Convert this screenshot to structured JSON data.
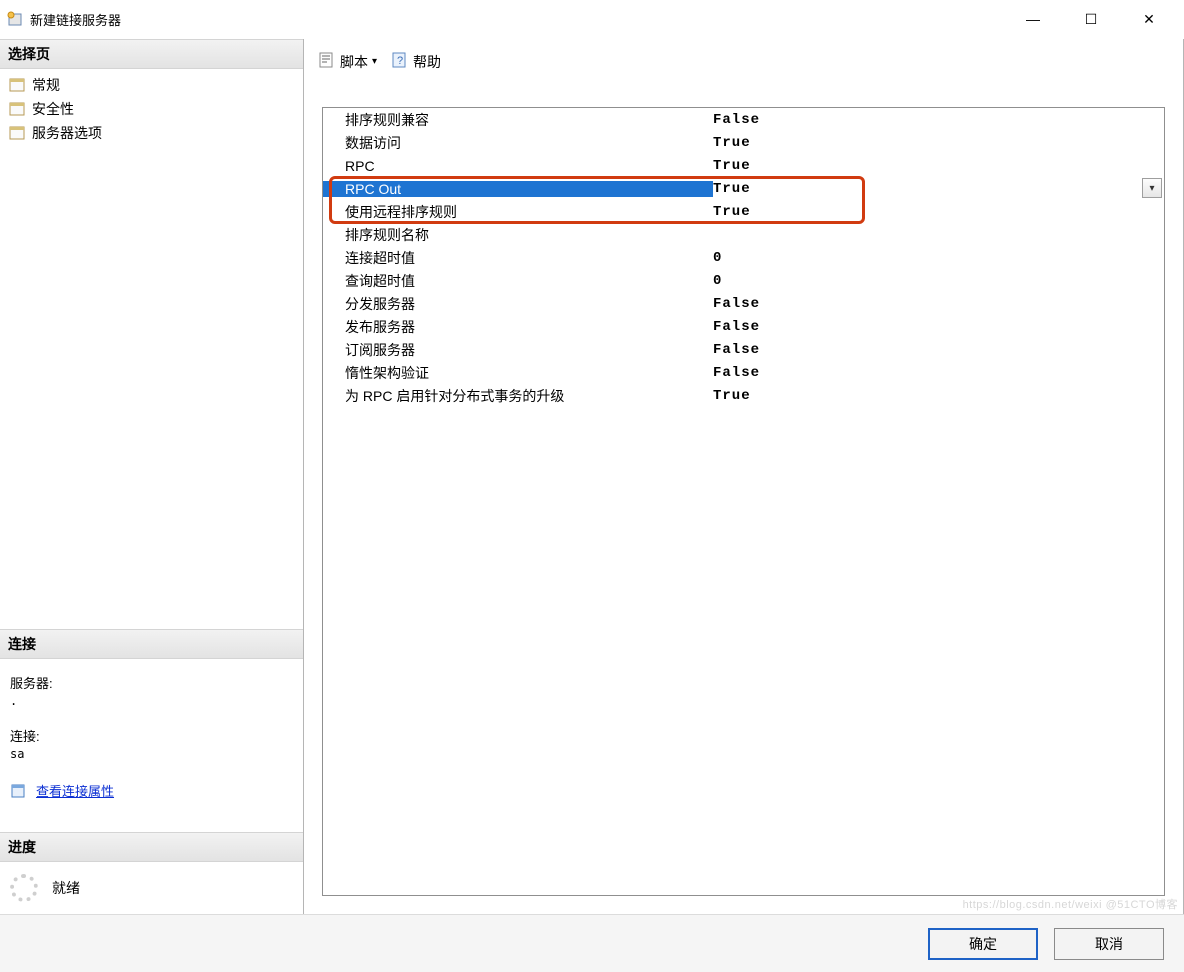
{
  "window": {
    "title": "新建链接服务器"
  },
  "winControls": {
    "minimize": "—",
    "maximize": "☐",
    "close": "✕"
  },
  "leftPane": {
    "selectPage": {
      "header": "选择页",
      "items": [
        "常规",
        "安全性",
        "服务器选项"
      ]
    },
    "connection": {
      "header": "连接",
      "serverLabel": "服务器:",
      "serverValue": ".",
      "connLabel": "连接:",
      "connValue": "sa",
      "viewPropsLink": "查看连接属性"
    },
    "progress": {
      "header": "进度",
      "status": "就绪"
    }
  },
  "toolbar": {
    "script": "脚本",
    "help": "帮助"
  },
  "properties": [
    {
      "key": "排序规则兼容",
      "value": "False"
    },
    {
      "key": "数据访问",
      "value": "True"
    },
    {
      "key": "RPC",
      "value": "True"
    },
    {
      "key": "RPC Out",
      "value": "True",
      "selected": true,
      "highlight": true
    },
    {
      "key": "使用远程排序规则",
      "value": "True",
      "highlight": true
    },
    {
      "key": "排序规则名称",
      "value": ""
    },
    {
      "key": "连接超时值",
      "value": "0"
    },
    {
      "key": "查询超时值",
      "value": "0"
    },
    {
      "key": "分发服务器",
      "value": "False"
    },
    {
      "key": "发布服务器",
      "value": "False"
    },
    {
      "key": "订阅服务器",
      "value": "False"
    },
    {
      "key": "惰性架构验证",
      "value": "False"
    },
    {
      "key": "为 RPC 启用针对分布式事务的升级",
      "value": "True"
    }
  ],
  "footer": {
    "ok": "确定",
    "cancel": "取消"
  },
  "watermark": "https://blog.csdn.net/weixi  @51CTO博客"
}
